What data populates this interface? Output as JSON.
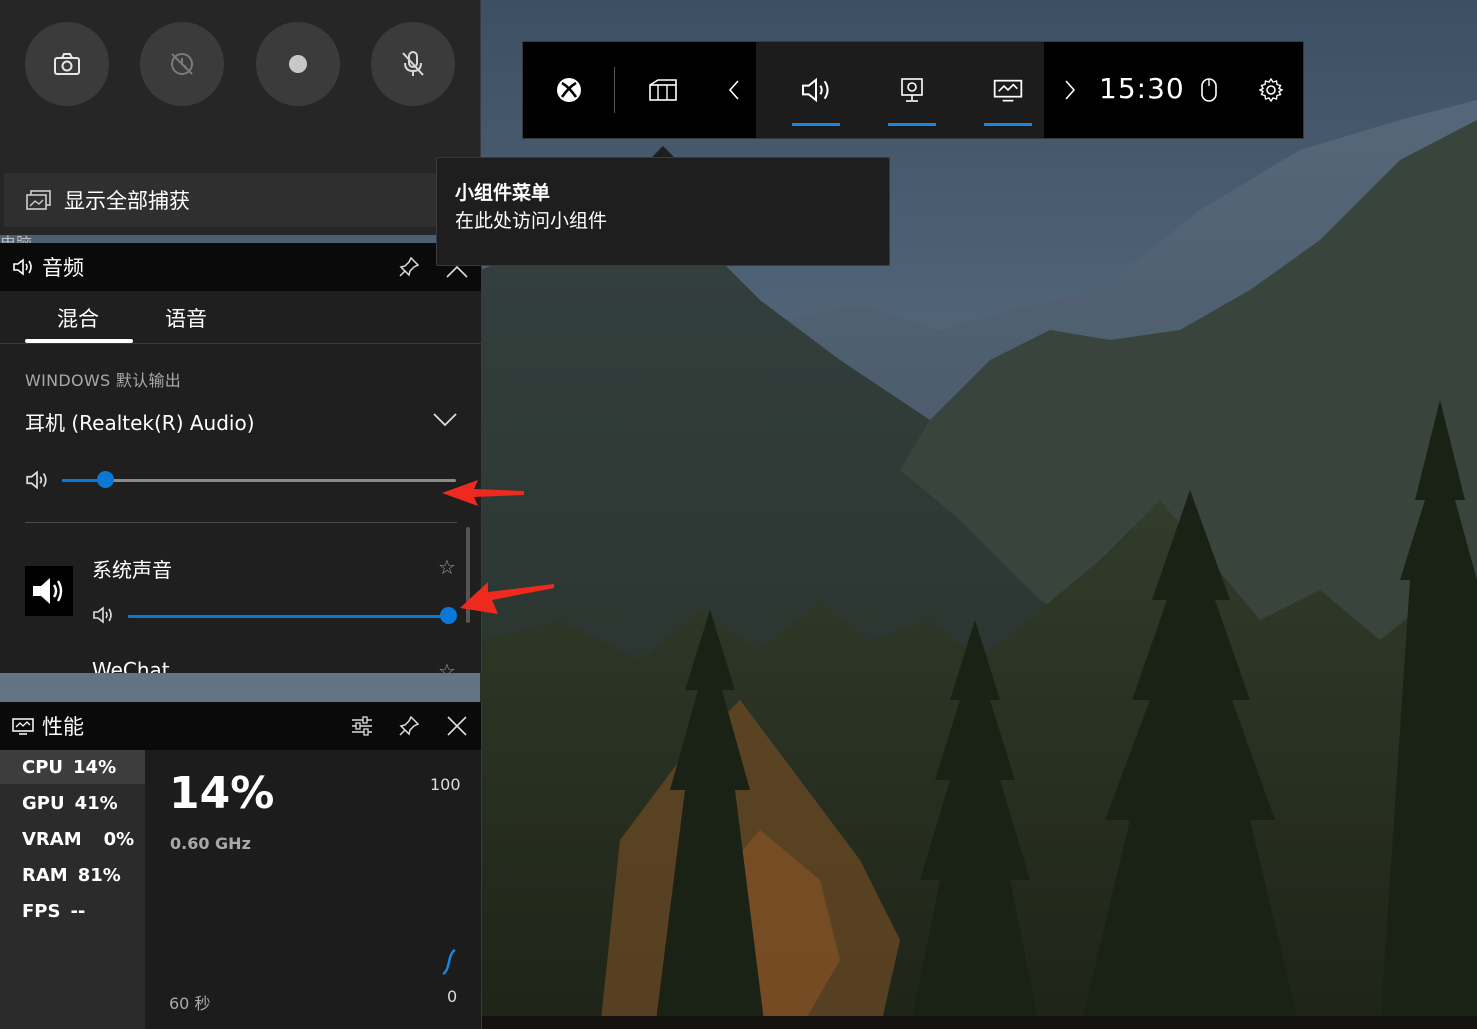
{
  "capture": {
    "buttons": [
      {
        "icon": "camera-icon"
      },
      {
        "icon": "record-last-icon"
      },
      {
        "icon": "record-dot-icon"
      },
      {
        "icon": "mic-off-icon"
      }
    ],
    "show_all_label": "显示全部捕获",
    "peek_text": "电脑"
  },
  "audio": {
    "title": "音频",
    "tabs": [
      "混合",
      "语音"
    ],
    "active_tab": 0,
    "section_label": "WINDOWS 默认输出",
    "device": "耳机 (Realtek(R) Audio)",
    "master_volume": 0.11,
    "apps": [
      {
        "name": "系统声音",
        "volume": 1.0
      },
      {
        "name": "WeChat"
      }
    ],
    "accent": "#0a78d7"
  },
  "performance": {
    "title": "性能",
    "stats": [
      {
        "label": "CPU",
        "value": "14%"
      },
      {
        "label": "GPU",
        "value": "41%"
      },
      {
        "label": "VRAM",
        "value": "0%"
      },
      {
        "label": "RAM",
        "value": "81%"
      },
      {
        "label": "FPS",
        "value": "--"
      }
    ],
    "selected": 0,
    "big_value": "14%",
    "freq": "0.60 GHz",
    "axis_max": "100",
    "axis_min": "0",
    "time_label": "60 秒"
  },
  "gamebar": {
    "time": "15:30",
    "active_underline_color": "#1a86e0"
  },
  "tooltip": {
    "title": "小组件菜单",
    "subtitle": "在此处访问小组件"
  }
}
